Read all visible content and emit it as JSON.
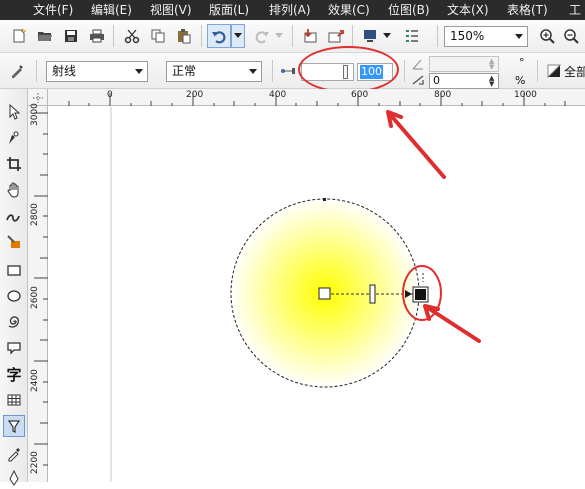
{
  "menu": [
    "文件(F)",
    "编辑(E)",
    "视图(V)",
    "版面(L)",
    "排列(A)",
    "效果(C)",
    "位图(B)",
    "文本(X)",
    "表格(T)",
    "工"
  ],
  "toolbar": {
    "zoom_value": "150%"
  },
  "property_bar": {
    "fill_type": "射线",
    "merge_mode": "正常",
    "midpoint_value": "100",
    "angle_value": "",
    "angle_unit": "°",
    "edge_pad_value": "0",
    "edge_pad_unit": "%",
    "all_label": "全部"
  },
  "ruler_top": [
    "0",
    "200",
    "400",
    "600",
    "800",
    "1000"
  ],
  "ruler_left": [
    "3000",
    "2800",
    "2600",
    "2400",
    "2200"
  ],
  "colors": {
    "fill_center": "#ffff00",
    "fill_edge": "#ffffff",
    "annotation": "#e02e2e"
  },
  "tool_icons": [
    "pick-tool-icon",
    "shape-tool-icon",
    "crop-tool-icon",
    "pan-tool-icon",
    "freehand-tool-icon",
    "smart-fill-tool-icon",
    "rectangle-tool-icon",
    "ellipse-tool-icon",
    "spiral-tool-icon",
    "callout-tool-icon",
    "text-tool-icon",
    "table-tool-icon",
    "interactive-fill-tool-icon",
    "eyedropper-tool-icon",
    "outline-pen-tool-icon"
  ]
}
